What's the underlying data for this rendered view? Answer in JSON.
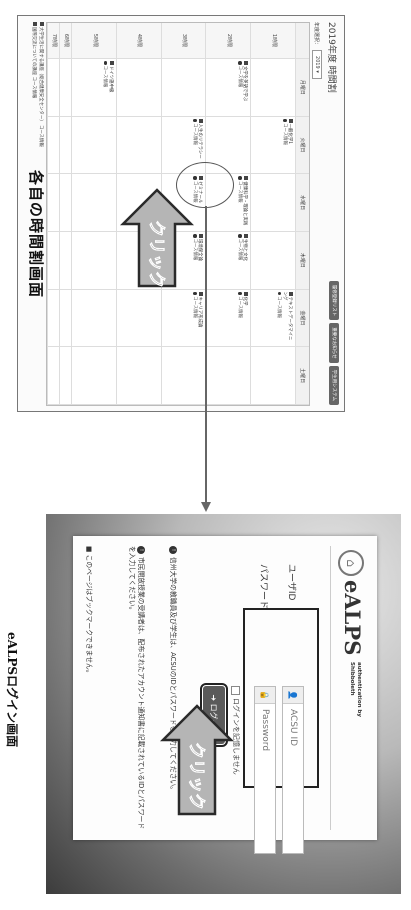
{
  "timetable": {
    "title": "2019年度 時間割",
    "year_label": "年度選択：",
    "year_value": "2019",
    "buttons": [
      "履修登録リスト",
      "重要なお知らせ",
      "学生用システム"
    ],
    "days": [
      "",
      "月曜日",
      "火曜日",
      "水曜日",
      "木曜日",
      "金曜日",
      "土曜日"
    ],
    "periods": [
      "1時限",
      "2時限",
      "3時限",
      "4時限",
      "5時限",
      "6時限",
      "7時限"
    ],
    "courses": {
      "tue1": "一般化学1",
      "fri1": "テキストデータマイニング",
      "mon2": "文学を英語で学ぶ",
      "thu2": "生物と文化",
      "wed2": "健康科学・理論と実践",
      "fri2": "化学",
      "tue3": "人生のリテラシー",
      "wed3": "ゼミナール",
      "thu3": "環境保全論",
      "fri3": "キャリア形成論",
      "mon5": "ドイツ語中級"
    },
    "info_label": "コース情報",
    "footer_lines": [
      "大学生活に関する講座（総合健康安全センター） コース情報",
      "国際交流についての講座 コース情報"
    ]
  },
  "login": {
    "logo": "eALPS",
    "logo_sub_1": "authentication by",
    "logo_sub_2": "Shibboleth",
    "user_label": "ユーザID",
    "password_label": "パスワード",
    "user_placeholder": "ACSU ID",
    "password_placeholder": "Password",
    "remember_label": "ログインを記憶しません",
    "login_button": "ログイン",
    "notice_1": "信州大学の教職員及び学生は、ACSUのIDとパスワードを入力してください。",
    "notice_2": "市民開放授業の受講者は、配布されたアカウント通知書に記載されているIDとパスワードを入力してください。",
    "footer": "このページはブックマークできません。"
  },
  "annotations": {
    "click_text": "クリック",
    "caption_left": "各自の時間割画面",
    "caption_right": "eALPSログイン画面"
  },
  "colors": {
    "arrow_fill": "#b5b5b5",
    "arrow_stroke": "#2a2a2a",
    "connector": "#666666"
  },
  "icons": [
    "user-icon",
    "lock-icon",
    "login-icon",
    "check-box-icon",
    "notice-number-icon"
  ]
}
